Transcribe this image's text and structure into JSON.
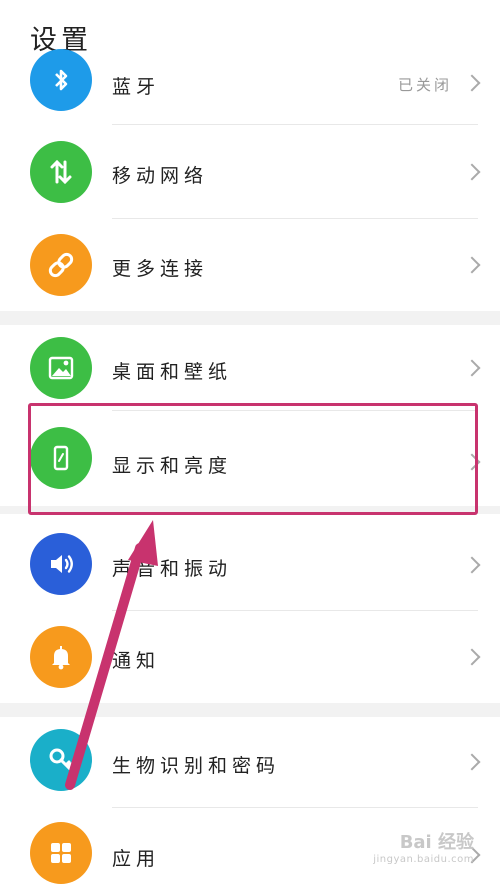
{
  "title": "设置",
  "items": [
    {
      "label": "蓝牙",
      "value": "已关闭",
      "icon": "bluetooth-icon",
      "color": "#1E9BE9"
    },
    {
      "label": "移动网络",
      "icon": "mobile-data-icon",
      "color": "#3DBE45"
    },
    {
      "label": "更多连接",
      "icon": "link-icon",
      "color": "#F79A1D"
    },
    {
      "label": "桌面和壁纸",
      "icon": "wallpaper-icon",
      "color": "#3DBE45"
    },
    {
      "label": "显示和亮度",
      "icon": "display-icon",
      "color": "#3DBE45"
    },
    {
      "label": "声音和振动",
      "icon": "speaker-icon",
      "color": "#2A5FD9"
    },
    {
      "label": "通知",
      "icon": "bell-icon",
      "color": "#F79A1D"
    },
    {
      "label": "生物识别和密码",
      "icon": "key-icon",
      "color": "#1AAFC9"
    },
    {
      "label": "应用",
      "icon": "apps-icon",
      "color": "#F79A1D"
    }
  ],
  "annotation_color": "#C8336E",
  "watermark": {
    "main": "Bai 经验",
    "sub": "jingyan.baidu.com"
  }
}
